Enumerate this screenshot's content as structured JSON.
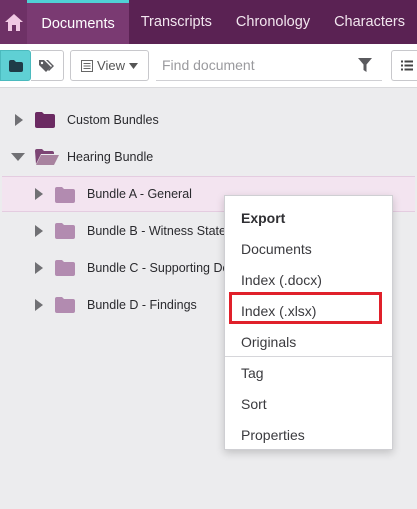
{
  "nav": {
    "home_icon": "home-icon",
    "tabs": [
      {
        "label": "Documents",
        "active": true
      },
      {
        "label": "Transcripts",
        "active": false
      },
      {
        "label": "Chronology",
        "active": false
      },
      {
        "label": "Characters",
        "active": false
      }
    ]
  },
  "toolbar": {
    "view_label": "View",
    "search_placeholder": "Find document"
  },
  "tree": {
    "items": [
      {
        "label": "Custom Bundles"
      },
      {
        "label": "Hearing Bundle"
      },
      {
        "label": "Bundle A - General"
      },
      {
        "label": "Bundle B - Witness Statem"
      },
      {
        "label": "Bundle C - Supporting Doc"
      },
      {
        "label": "Bundle D - Findings"
      }
    ]
  },
  "context_menu": {
    "header": "Export",
    "export_items": [
      "Documents",
      "Index (.docx)",
      "Index (.xlsx)",
      "Originals"
    ],
    "other_items": [
      "Tag",
      "Sort",
      "Properties"
    ]
  },
  "colors": {
    "nav_bg": "#5a2253",
    "active_tab_bg": "#7a3a72",
    "active_tab_accent": "#4fd1d6",
    "folder_dark": "#6b2a62",
    "folder_light": "#b28bb0",
    "selected_row": "#f3e4f0",
    "highlight": "#e0202a"
  }
}
